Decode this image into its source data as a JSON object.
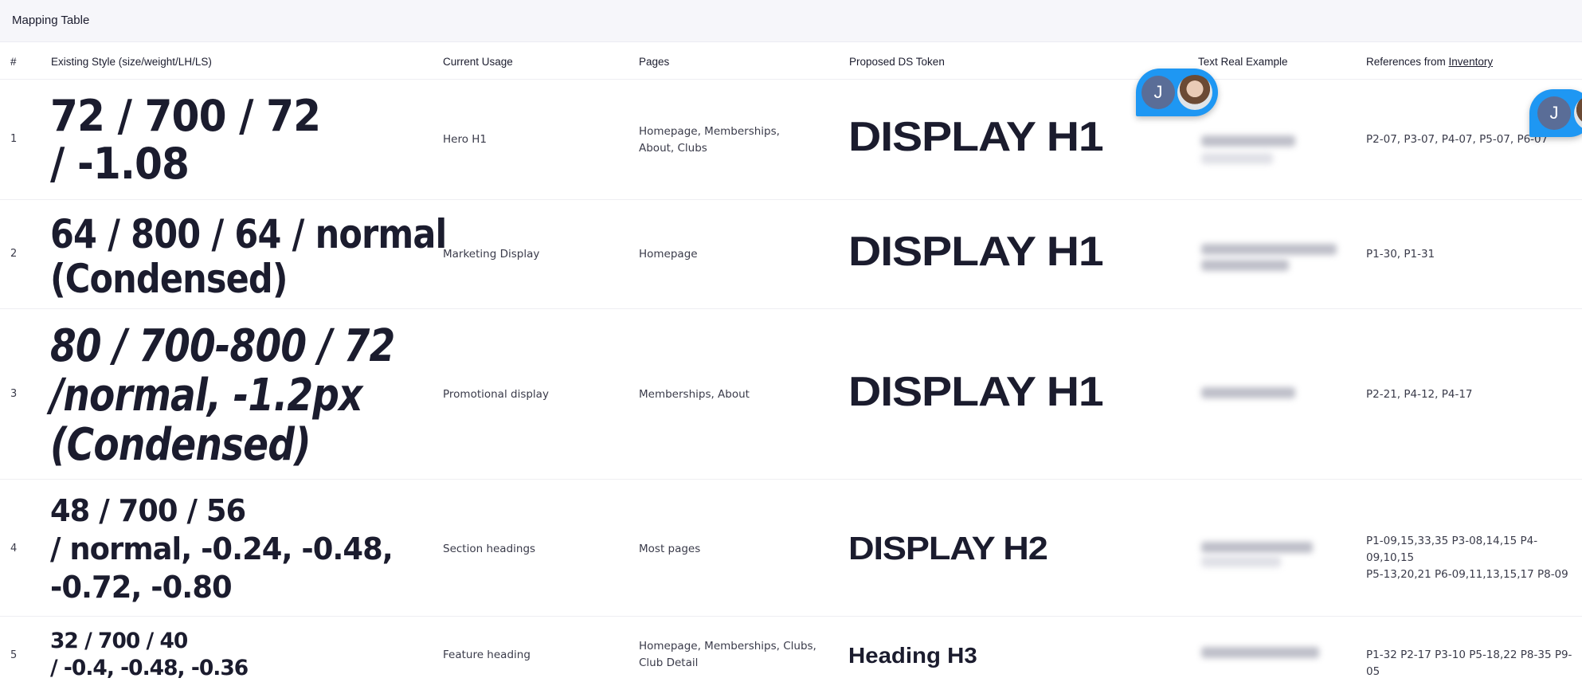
{
  "window": {
    "title": "Mapping Table"
  },
  "columns": {
    "num": "#",
    "existing": "Existing Style (size/weight/LH/LS)",
    "usage": "Current Usage",
    "pages": "Pages",
    "token": "Proposed DS Token",
    "example": "Text Real Example",
    "refs_prefix": "References from ",
    "refs_link": "Inventory"
  },
  "rows": [
    {
      "num": "1",
      "existing_lines": [
        "72 / 700 / 72",
        "/ -1.08"
      ],
      "usage": "Hero H1",
      "pages": "Homepage, Memberships, About, Clubs",
      "token": "DISPLAY H1",
      "refs": "P2-07, P3-07, P4-07, P5-07, P6-07"
    },
    {
      "num": "2",
      "existing_lines": [
        "64 / 800 / 64 / normal",
        "(Condensed)"
      ],
      "usage": "Marketing Display",
      "pages": "Homepage",
      "token": "DISPLAY H1",
      "refs": "P1-30, P1-31"
    },
    {
      "num": "3",
      "existing_lines": [
        "80 / 700-800 / 72",
        "/normal, -1.2px",
        "(Condensed)"
      ],
      "usage": "Promotional display",
      "pages": "Memberships, About",
      "token": "DISPLAY H1",
      "refs": "P2-21, P4-12, P4-17"
    },
    {
      "num": "4",
      "existing_lines": [
        "48 / 700 / 56",
        "/ normal, -0.24, -0.48,",
        "-0.72, -0.80"
      ],
      "usage": "Section headings",
      "pages": "Most pages",
      "token": "DISPLAY H2",
      "refs_lines": [
        "P1-09,15,33,35 P3-08,14,15 P4-09,10,15",
        "P5-13,20,21 P6-09,11,13,15,17 P8-09"
      ]
    },
    {
      "num": "5",
      "existing_lines": [
        "32 / 700 / 40",
        "/ -0.4, -0.48, -0.36"
      ],
      "usage": "Feature heading",
      "pages": "Homepage, Memberships, Clubs, Club Detail",
      "token": "Heading H3",
      "refs": "P1-32 P2-17 P3-10 P5-18,22 P8-35 P9-05"
    }
  ],
  "collaborators": [
    {
      "initial": "J",
      "icon": "user-photo-avatar"
    },
    {
      "initial": "J",
      "icon": "user-photo-avatar"
    }
  ],
  "colors": {
    "accent": "#1e97f3",
    "text": "#1b1c2e",
    "avatar_j": "#5a6d97"
  }
}
